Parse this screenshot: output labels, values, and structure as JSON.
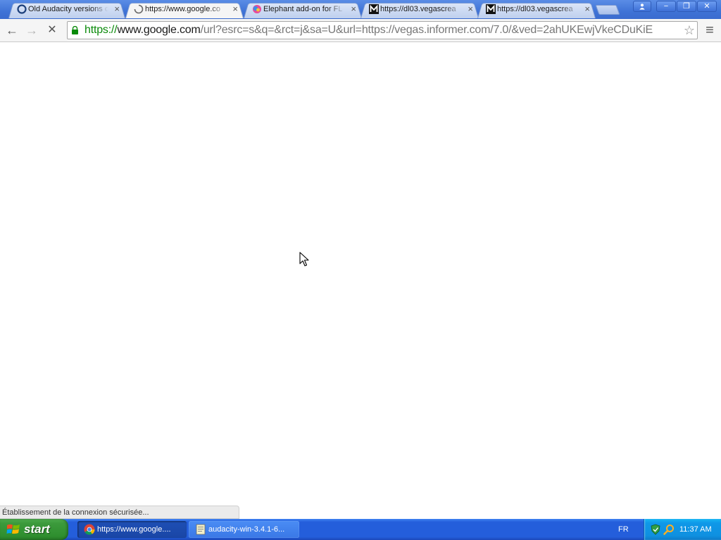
{
  "browser": {
    "tabs": [
      {
        "title": "Old Audacity versions o",
        "favicon": "audacity-circle-icon",
        "active": false
      },
      {
        "title": "https://www.google.co",
        "favicon": "loading-spinner-icon",
        "active": true
      },
      {
        "title": "Elephant add-on for FL",
        "favicon": "elephant-add-on-icon",
        "active": false
      },
      {
        "title": "https://dl03.vegascrea",
        "favicon": "m-logo-icon",
        "active": false
      },
      {
        "title": "https://dl03.vegascrea",
        "favicon": "m-logo-icon",
        "active": false
      }
    ],
    "tab_close_glyph": "×",
    "window_controls": {
      "minimize": "−",
      "restore": "❐",
      "close": "✕"
    },
    "toolbar": {
      "back": "←",
      "forward": "→",
      "stop": "✕",
      "menu": "≡"
    },
    "omnibox": {
      "scheme": "https://",
      "host": "www.google.com",
      "path": "/url?esrc=s&q=&rct=j&sa=U&url=https://vegas.informer.com/7.0/&ved=2ahUKEwjVkeCDuKiE"
    },
    "status_text": "Établissement de la connexion sécurisée..."
  },
  "taskbar": {
    "start_label": "start",
    "tasks": [
      {
        "label": "https://www.google....",
        "icon": "chrome-icon",
        "active": true
      },
      {
        "label": "audacity-win-3.4.1-6...",
        "icon": "folder-icon",
        "active": false
      }
    ],
    "language": "FR",
    "clock": "11:37 AM"
  },
  "colors": {
    "tabstrip": "#3f73d6",
    "secure_green": "#0a8a0a",
    "taskbar_blue": "#245edb",
    "start_green": "#3c9a3c",
    "tray_blue": "#0f98e8"
  }
}
